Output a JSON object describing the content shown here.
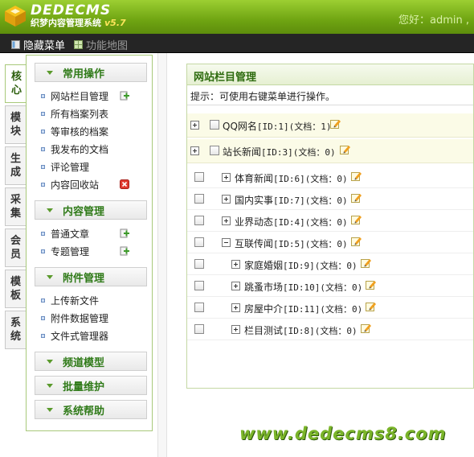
{
  "header": {
    "logo_title": "DEDECMS",
    "logo_sub": "织梦内容管理系统",
    "version": "v5.7",
    "greeting": "您好：admin ,"
  },
  "toolbar": {
    "hide_menu": "隐藏菜单",
    "site_map": "功能地图"
  },
  "vtabs": [
    "核心",
    "模块",
    "生成",
    "采集",
    "会员",
    "模板",
    "系统"
  ],
  "sidebar": {
    "groups": {
      "common": "常用操作",
      "content": "内容管理",
      "attach": "附件管理",
      "channel": "频道模型",
      "batch": "批量维护",
      "help": "系统帮助"
    },
    "common_items": [
      "网站栏目管理",
      "所有档案列表",
      "等审核的档案",
      "我发布的文档",
      "评论管理",
      "内容回收站"
    ],
    "content_items": [
      "普通文章",
      "专题管理"
    ],
    "attach_items": [
      "上传新文件",
      "附件数据管理",
      "文件式管理器"
    ]
  },
  "panel": {
    "title": "网站栏目管理",
    "tip": "提示：可使用右键菜单进行操作。",
    "rows": [
      {
        "name": "QQ网名",
        "id": "[ID:1]",
        "docs": "(文档：1)"
      },
      {
        "name": "站长新闻",
        "id": "[ID:3]",
        "docs": "(文档：0)"
      },
      {
        "name": "体育新闻",
        "id": "[ID:6]",
        "docs": "(文档：0)"
      },
      {
        "name": "国内实事",
        "id": "[ID:7]",
        "docs": "(文档：0)"
      },
      {
        "name": "业界动态",
        "id": "[ID:4]",
        "docs": "(文档：0)"
      },
      {
        "name": "互联传闻",
        "id": "[ID:5]",
        "docs": "(文档：0)"
      },
      {
        "name": "家庭婚姻",
        "id": "[ID:9]",
        "docs": "(文档：0)"
      },
      {
        "name": "跳蚤市场",
        "id": "[ID:10]",
        "docs": "(文档：0)"
      },
      {
        "name": "房屋中介",
        "id": "[ID:11]",
        "docs": "(文档：0)"
      },
      {
        "name": "栏目测试",
        "id": "[ID:8]",
        "docs": "(文档：0)"
      }
    ]
  },
  "watermark": "www.dedecms8.com",
  "colors": {
    "header_green": "#6fa412",
    "group_text": "#2f7a18",
    "panel_title": "#2d6b0e",
    "watermark": "#7bb52a"
  }
}
